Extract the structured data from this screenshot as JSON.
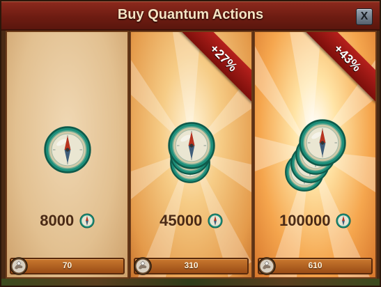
{
  "window": {
    "title": "Buy Quantum Actions",
    "close_label": "X"
  },
  "offers": [
    {
      "amount": "8000",
      "price": "70",
      "bonus": "",
      "coin_stack": 1
    },
    {
      "amount": "45000",
      "price": "310",
      "bonus": "+27%",
      "coin_stack": 3
    },
    {
      "amount": "100000",
      "price": "610",
      "bonus": "+43%",
      "coin_stack": 4
    }
  ],
  "icons": {
    "currency": "compass-coin-icon",
    "price": "diamond-hand-icon",
    "close": "close-icon"
  },
  "colors": {
    "title_bar": "#6e1c12",
    "ribbon": "#a31a16",
    "price_bar": "#b5652a",
    "amount_text": "#4a2a16"
  }
}
